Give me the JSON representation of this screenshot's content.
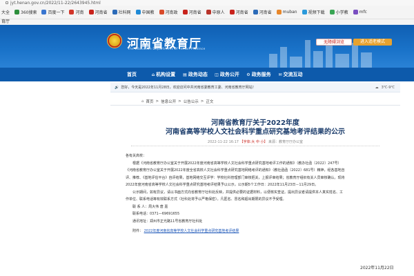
{
  "browser": {
    "url": "jyt.henan.gov.cn/2022/11-22/2643945.html",
    "bookmarks": [
      "大全",
      "360搜索",
      "百度一下",
      "河南",
      "河南省",
      "社科网",
      "中国教",
      "河南政",
      "河南省",
      "中原人",
      "河南省",
      "河南省",
      "muban",
      "视频下载",
      "小学教",
      "mfc"
    ],
    "bookmarks_row2": "育厅"
  },
  "banner": {
    "title": "河南省教育厅",
    "subtitle": "The Education Department Of Henan Province",
    "accessible_button": "无障碍浏览",
    "elder_button": "进入适老模式"
  },
  "nav": [
    "首页",
    "机构设置",
    "政务动态",
    "政务公开",
    "政务服务",
    "交流互动"
  ],
  "infobar": {
    "notice": "您好，今天是2022年11月28日，欢迎访问中共河南省委教育工委、河南省教育厅网站！",
    "weather": "3℃-9℃"
  },
  "breadcrumb": [
    "首页",
    "信息公开",
    "公告公示",
    "正文"
  ],
  "article": {
    "title_line1": "河南省教育厅关于2022年度",
    "title_line2": "河南省高等学校人文社会科学重点研究基地考评结果的公示",
    "meta_date": "2022-11-22 16:17",
    "meta_fontsize": "【字体:大 中 小】",
    "meta_source": "来源：教育厅厅办公室",
    "greeting": "各有关高校：",
    "paragraphs": [
      "根据《河南省教育厅办公室关于开展2022年度河南省高等学校人文社会科学重点研究基地考评工作的通知》（教办社函〔2022〕247号）",
      "《河南省教育厅办公室关于开展2022年度全省高校人文社会科学重点研究基地网络考评的通知》（教社函函〔2022〕681号）精神，经各基地自",
      "评、推荐、《基地评估平台》自评结果，基地网络交互评学：学校社科管理部门审核把关，上报评审结果；省教育厅组织有关人员审核确认。现将",
      "2022年度河南省高等学校人文社会科学重点研究基地考评结果予以公示，公示期5个工作日：2022年11月23日－11月29日。"
    ],
    "paragraph2": [
      "公示期间，如有异议，请以书面方式向省教育厅社科处反映，并提供必要的证据材料，以便核实查证。提出异议者请提供本人真实姓名、工",
      "作单位、联系电话等有效联系方式（社科处将予以严格保密）。凡匿名、冒名和超出期限的异议不予受理。"
    ],
    "contact": "联 系 人：周大伟 唐 嘉",
    "phone": "联系电话：0371—69691655",
    "address": "通讯地址：郑州市正光路11号省教育厅社科处",
    "attachment_label": "附件：",
    "attachment_link": "2022年度河南省高等学校人文社会科学重点研究基地考评结果",
    "sign_date": "2022年11月22日"
  },
  "colors": {
    "banner_blue": "#1a73c9",
    "nav_blue": "#0d5aab",
    "title_navy": "#1b3c6b",
    "accent_red": "#c8231c",
    "elder_orange": "#e7a22f"
  }
}
